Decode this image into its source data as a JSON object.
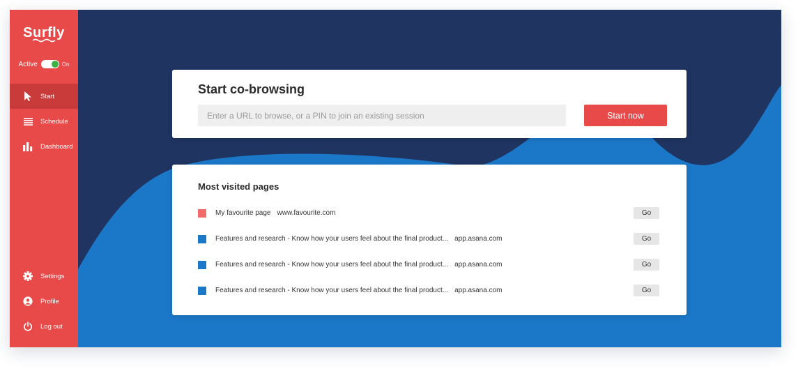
{
  "brand": {
    "name": "Surfly"
  },
  "status": {
    "label": "Active",
    "toggle_text": "On"
  },
  "sidebar": {
    "top_items": [
      {
        "label": "Start",
        "icon": "cursor-arrow-icon"
      },
      {
        "label": "Schedule",
        "icon": "list-lines-icon"
      },
      {
        "label": "Dashboard",
        "icon": "bar-chart-icon"
      }
    ],
    "bottom_items": [
      {
        "label": "Settings",
        "icon": "gear-icon"
      },
      {
        "label": "Profile",
        "icon": "user-icon"
      },
      {
        "label": "Log out",
        "icon": "power-icon"
      }
    ]
  },
  "cobrowse": {
    "title": "Start co-browsing",
    "input_value": "",
    "input_placeholder": "Enter a URL to browse, or a PIN to join an existing session",
    "button_label": "Start now"
  },
  "visited": {
    "title": "Most visited pages",
    "go_label": "Go",
    "rows": [
      {
        "page": "My favourite page",
        "url": "www.favourite.com",
        "color": "#f26b6b"
      },
      {
        "page": "Features and research - Know how your users feel about the final product...",
        "url": "app.asana.com",
        "color": "#1b78c8"
      },
      {
        "page": "Features and research - Know how your users feel about the final product...",
        "url": "app.asana.com",
        "color": "#1b78c8"
      },
      {
        "page": "Features and research - Know how your users feel about the final product...",
        "url": "app.asana.com",
        "color": "#1b78c8"
      }
    ]
  },
  "colors": {
    "sidebar_bg": "#e84a4a",
    "sidebar_selected": "#c93a3a",
    "navy": "#1f3461",
    "blue": "#1b78c8",
    "accent": "#e84a4a",
    "toggle_green": "#3cb043"
  }
}
